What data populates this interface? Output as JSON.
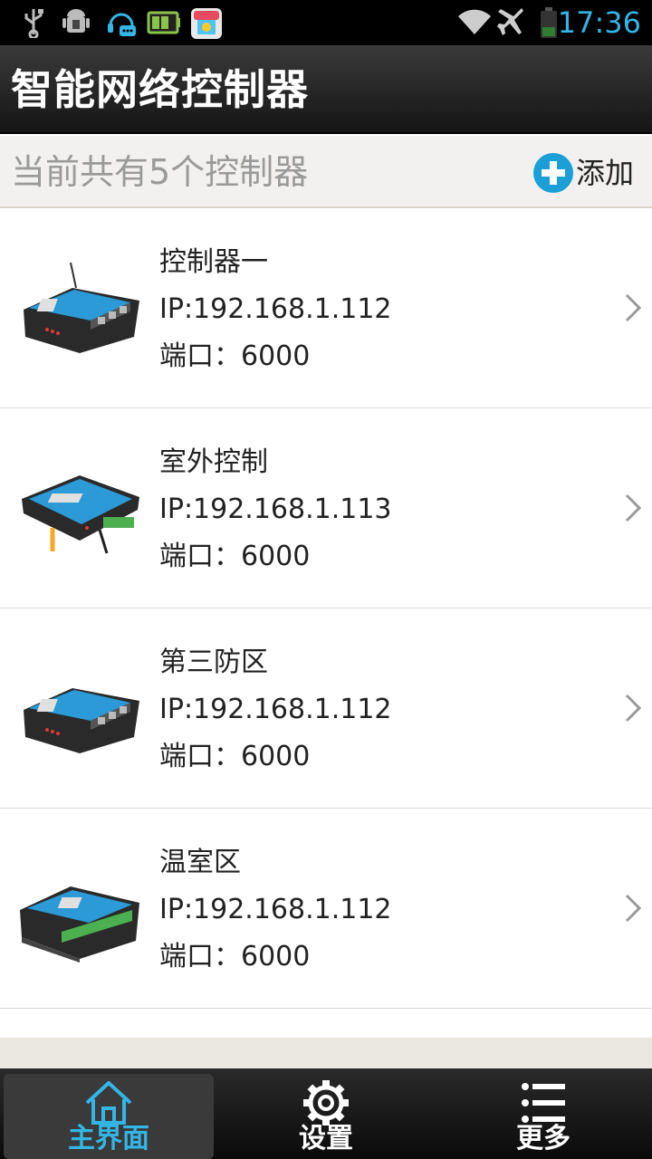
{
  "status_bar": {
    "time": "17:36",
    "icons": [
      "usb-icon",
      "android-debug-icon",
      "headset-message-icon",
      "battery-app-icon",
      "app-store-icon",
      "wifi-icon",
      "airplane-icon",
      "battery-icon"
    ]
  },
  "app": {
    "title": "智能网络控制器"
  },
  "header": {
    "count_text": "当前共有5个控制器",
    "add_label": "添加"
  },
  "devices": [
    {
      "name": "控制器一",
      "ip": "IP:192.168.1.112",
      "port": "端口：6000"
    },
    {
      "name": "室外控制",
      "ip": "IP:192.168.1.113",
      "port": "端口：6000"
    },
    {
      "name": "第三防区",
      "ip": "IP:192.168.1.112",
      "port": "端口：6000"
    },
    {
      "name": "温室区",
      "ip": "IP:192.168.1.112",
      "port": "端口：6000"
    }
  ],
  "nav": {
    "tabs": [
      {
        "label": "主界面",
        "icon": "home-icon",
        "active": true
      },
      {
        "label": "设置",
        "icon": "gear-icon",
        "active": false
      },
      {
        "label": "更多",
        "icon": "list-icon",
        "active": false
      }
    ]
  },
  "colors": {
    "accent": "#33b5e5",
    "title_bar": "#1e1e1e",
    "header_bg": "#f2f1ef",
    "add_icon": "#1a9fd6",
    "device_body": "#2b9ad6"
  }
}
